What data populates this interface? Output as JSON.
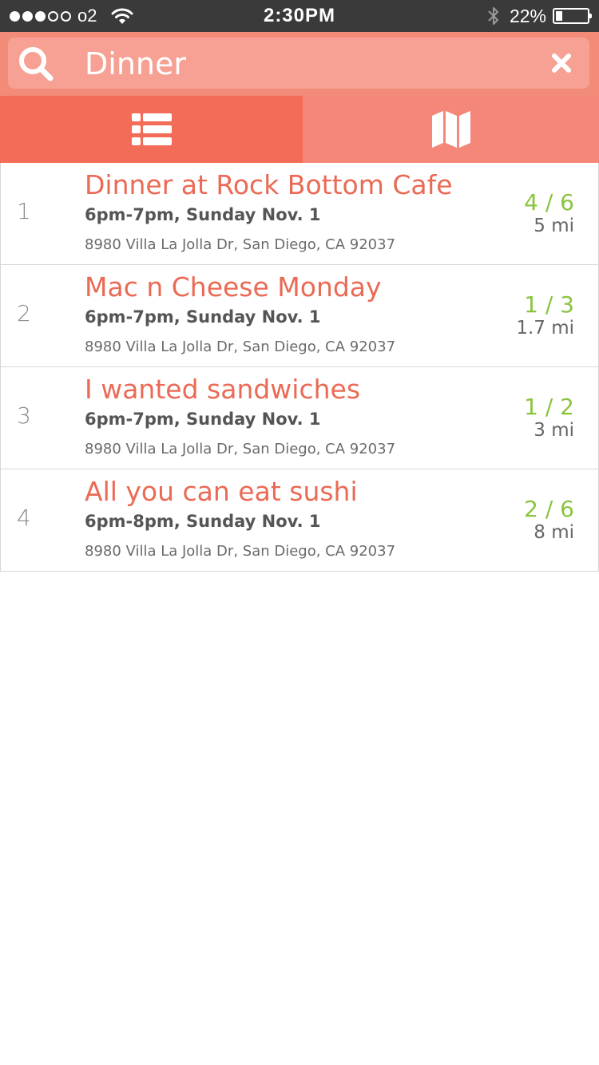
{
  "status_bar": {
    "carrier": "o2",
    "time": "2:30PM",
    "battery_percent": "22%",
    "battery_level": 0.22,
    "signal_bars_filled": 3,
    "signal_bars_total": 5
  },
  "search": {
    "value": "Dinner",
    "icon": "search-icon",
    "clear_icon": "close-icon"
  },
  "tabs": [
    {
      "name": "list",
      "icon": "list-icon",
      "active": true
    },
    {
      "name": "map",
      "icon": "map-icon",
      "active": false
    }
  ],
  "colors": {
    "status_bar": "#3a3a3a",
    "header": "#f28b78",
    "search_box": "#f6a193",
    "tab_active": "#f26c57",
    "tab_inactive": "#f5877a",
    "title": "#ea6a55",
    "count": "#8ac43f"
  },
  "events": [
    {
      "index": "1",
      "title": "Dinner at Rock Bottom Cafe",
      "time": "6pm-7pm, Sunday Nov. 1",
      "address": "8980 Villa La Jolla Dr, San Diego, CA 92037",
      "count": "4 / 6",
      "distance": "5 mi"
    },
    {
      "index": "2",
      "title": "Mac n Cheese Monday",
      "time": "6pm-7pm, Sunday Nov. 1",
      "address": "8980 Villa La Jolla Dr, San Diego, CA 92037",
      "count": "1 / 3",
      "distance": "1.7 mi"
    },
    {
      "index": "3",
      "title": "I wanted sandwiches",
      "time": "6pm-7pm, Sunday Nov. 1",
      "address": "8980 Villa La Jolla Dr, San Diego, CA 92037",
      "count": "1 / 2",
      "distance": "3 mi"
    },
    {
      "index": "4",
      "title": "All you can eat sushi",
      "time": "6pm-8pm, Sunday Nov. 1",
      "address": "8980 Villa La Jolla Dr, San Diego, CA 92037",
      "count": "2 / 6",
      "distance": "8 mi"
    }
  ]
}
